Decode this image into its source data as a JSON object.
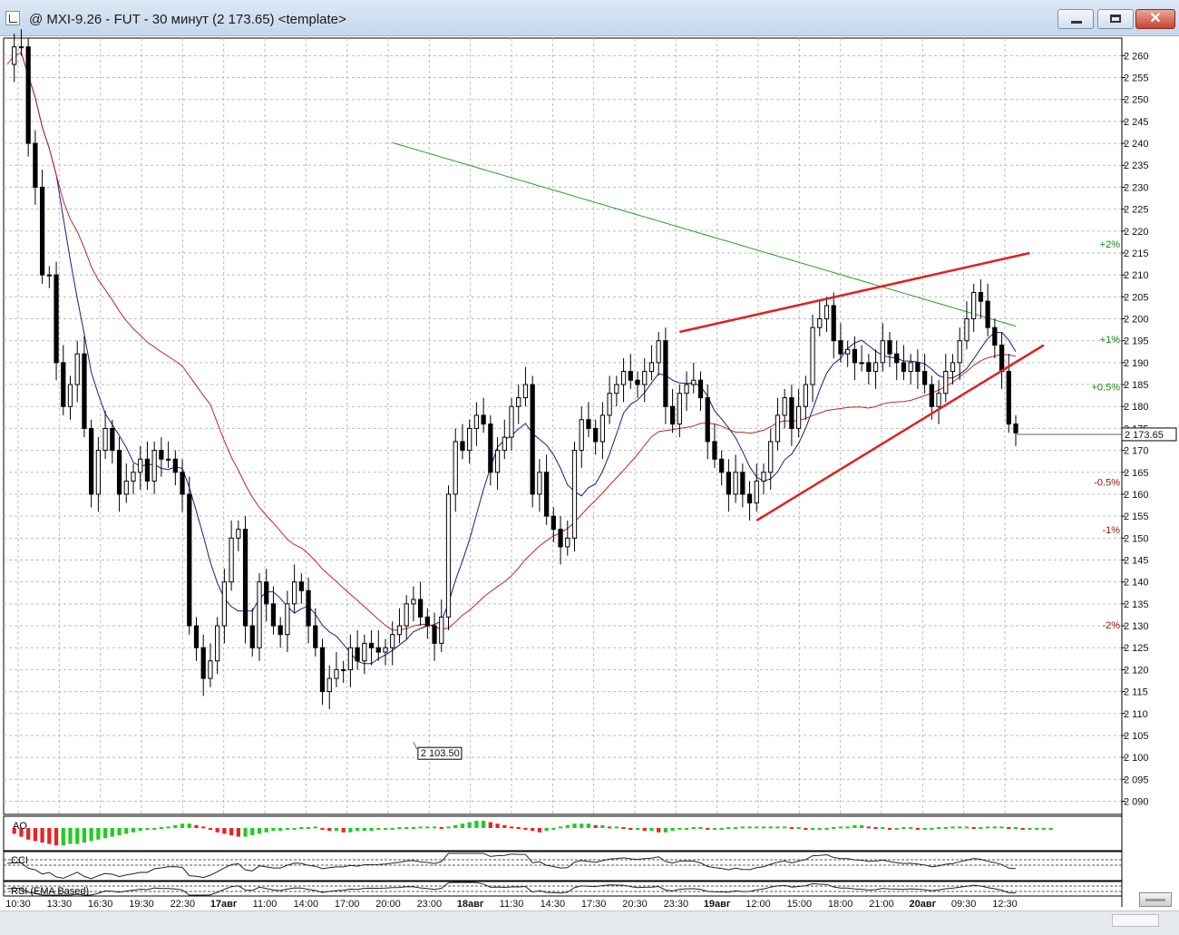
{
  "window": {
    "title": "@ MXI-9.26 - FUT - 30 минут (2 173.65) <template>",
    "minimize_label": "minimize",
    "maximize_label": "maximize",
    "close_label": "✕"
  },
  "colors": {
    "ma_fast": "#1a1a8c",
    "ma_mid": "#cc2222",
    "ma_slow": "#22a022",
    "trendline": "#e02020",
    "ao_up": "#22cc22",
    "ao_down": "#ee2222",
    "pct_up": "#0a8a0a",
    "pct_down": "#aa0a0a"
  },
  "chart_data": {
    "type": "candlestick",
    "title": "",
    "x_ticks": [
      "10:30",
      "13:30",
      "16:30",
      "19:30",
      "22:30",
      "17авг",
      "11:00",
      "14:00",
      "17:00",
      "20:00",
      "23:00",
      "18авг",
      "11:30",
      "14:30",
      "17:30",
      "20:30",
      "23:30",
      "19авг",
      "12:00",
      "15:00",
      "18:00",
      "21:00",
      "20авг",
      "09:30",
      "12:30"
    ],
    "x_ticks_bold": [
      "17авг",
      "18авг",
      "19авг",
      "20авг"
    ],
    "y_ticks": [
      2260,
      2255,
      2250,
      2245,
      2240,
      2235,
      2230,
      2225,
      2220,
      2215,
      2210,
      2205,
      2200,
      2195,
      2190,
      2185,
      2180,
      2175,
      2170,
      2165,
      2160,
      2155,
      2150,
      2145,
      2140,
      2135,
      2130,
      2125,
      2120,
      2115,
      2110,
      2105,
      2100,
      2095,
      2090
    ],
    "ylim": [
      2087,
      2264
    ],
    "last_price_label": "2 173.65",
    "last_price": 2173.65,
    "low_label": "2 103.50",
    "low_price": 2103.5,
    "percent_levels": [
      {
        "label": "+2%",
        "value": 2217.1
      },
      {
        "label": "+1%",
        "value": 2195.4
      },
      {
        "label": "+0.5%",
        "value": 2184.5
      },
      {
        "label": "-0.5%",
        "value": 2162.8
      },
      {
        "label": "-1%",
        "value": 2151.9
      },
      {
        "label": "-2%",
        "value": 2130.2
      }
    ],
    "closes": [
      2258,
      2262,
      2262,
      2240,
      2230,
      2210,
      2210,
      2190,
      2180,
      2185,
      2192,
      2175,
      2160,
      2170,
      2175,
      2170,
      2160,
      2163,
      2165,
      2168,
      2163,
      2170,
      2168,
      2168,
      2165,
      2160,
      2130,
      2125,
      2118,
      2122,
      2130,
      2140,
      2150,
      2152,
      2130,
      2125,
      2140,
      2135,
      2130,
      2128,
      2135,
      2140,
      2138,
      2130,
      2125,
      2115,
      2118,
      2120,
      2120,
      2125,
      2122,
      2126,
      2125,
      2124,
      2125,
      2128,
      2130,
      2135,
      2136,
      2132,
      2130,
      2126,
      2132,
      2160,
      2172,
      2170,
      2175,
      2178,
      2176,
      2165,
      2170,
      2173,
      2180,
      2182,
      2185,
      2160,
      2165,
      2155,
      2152,
      2148,
      2150,
      2170,
      2177,
      2175,
      2172,
      2178,
      2183,
      2185,
      2188,
      2186,
      2185,
      2188,
      2190,
      2195,
      2180,
      2176,
      2183,
      2185,
      2186,
      2182,
      2172,
      2168,
      2165,
      2160,
      2165,
      2160,
      2158,
      2163,
      2165,
      2172,
      2178,
      2182,
      2175,
      2180,
      2185,
      2198,
      2200,
      2203,
      2195,
      2192,
      2193,
      2190,
      2190,
      2188,
      2190,
      2195,
      2192,
      2190,
      2188,
      2190,
      2188,
      2185,
      2180,
      2183,
      2188,
      2190,
      2195,
      2200,
      2206,
      2204,
      2198,
      2194,
      2188,
      2176,
      2174
    ]
  },
  "indicators": {
    "ao_label": "AO",
    "cci_label": "CCI",
    "rsi_label": "RSI (EMA Based)",
    "ao_values": [
      -2,
      -4,
      -6,
      -8,
      -9,
      -10,
      -11,
      -12,
      -12,
      -11,
      -11,
      -10,
      -9,
      -8,
      -7,
      -6,
      -5,
      -4,
      -3,
      -2,
      -1,
      -1,
      0,
      1,
      2,
      3,
      3,
      2,
      1,
      -1,
      -3,
      -4,
      -5,
      -6,
      -6,
      -5,
      -4,
      -3,
      -2,
      -2,
      -1,
      -1,
      0,
      0,
      1,
      -1,
      -2,
      -2,
      -3,
      -3,
      -2,
      -2,
      -2,
      -1,
      -1,
      -1,
      0,
      0,
      0,
      1,
      1,
      1,
      0,
      1,
      2,
      3,
      4,
      5,
      5,
      4,
      3,
      2,
      1,
      0,
      -1,
      -2,
      -3,
      -2,
      -1,
      1,
      2,
      3,
      3,
      3,
      2,
      2,
      1,
      1,
      0,
      -1,
      -1,
      -2,
      -2,
      -3,
      -3,
      -2,
      -1,
      -1,
      0,
      0,
      -1,
      -1,
      -1,
      0,
      0,
      1,
      1,
      1,
      1,
      1,
      1,
      1,
      0,
      0,
      -1,
      -1,
      -1,
      -1,
      0,
      1,
      1,
      2,
      2,
      1,
      0,
      0,
      -1,
      -1,
      0,
      0,
      -1,
      -1,
      -1,
      0,
      0,
      1,
      1,
      1,
      0,
      0,
      1,
      1,
      1,
      0,
      0,
      -1,
      -1,
      -1,
      -1,
      -1
    ]
  }
}
